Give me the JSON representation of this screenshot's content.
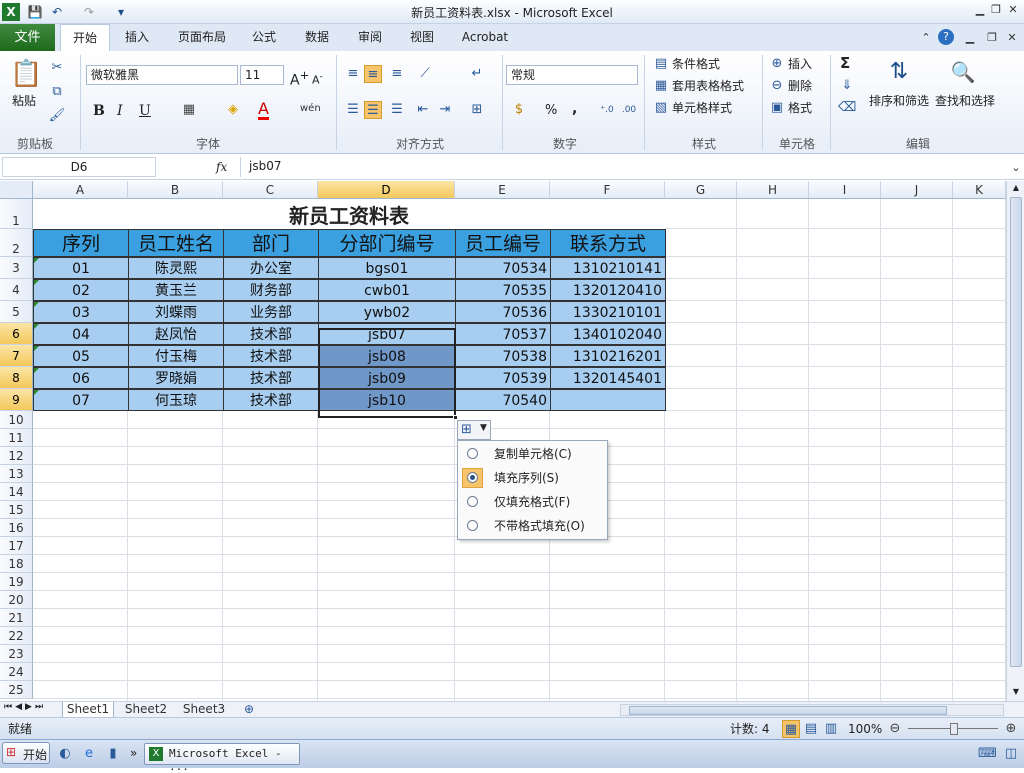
{
  "app": {
    "title": "新员工资料表.xlsx - Microsoft Excel"
  },
  "ribbon_tabs": [
    "开始",
    "插入",
    "页面布局",
    "公式",
    "数据",
    "审阅",
    "视图",
    "Acrobat"
  ],
  "file_tab": "文件",
  "clipboard": {
    "paste": "粘贴",
    "group": "剪贴板"
  },
  "font": {
    "name": "微软雅黑",
    "size": "11",
    "group": "字体",
    "bold": "B",
    "italic": "I",
    "underline": "U",
    "wen": "wén"
  },
  "align": {
    "group": "对齐方式"
  },
  "number": {
    "format": "常规",
    "group": "数字",
    "percent": "%",
    "comma": ",",
    "inc": "+.0 .00",
    "dec": ".00 +.0"
  },
  "styles": {
    "cond": "条件格式",
    "table": "套用表格格式",
    "cell": "单元格样式",
    "group": "样式"
  },
  "cells": {
    "insert": "插入",
    "delete": "删除",
    "format": "格式",
    "group": "单元格"
  },
  "editing": {
    "sort": "排序和筛选",
    "find": "查找和选择",
    "group": "编辑",
    "sum": "Σ"
  },
  "formula_bar": {
    "name_box": "D6",
    "fx": "fx",
    "value": "jsb07"
  },
  "columns": [
    "A",
    "B",
    "C",
    "D",
    "E",
    "F",
    "G",
    "H",
    "I",
    "J",
    "K"
  ],
  "rows": [
    "1",
    "2",
    "3",
    "4",
    "5",
    "6",
    "7",
    "8",
    "9",
    "10",
    "11",
    "12",
    "13",
    "14",
    "15",
    "16",
    "17",
    "18",
    "19",
    "20",
    "21",
    "22",
    "23",
    "24",
    "25"
  ],
  "sheet_title": "新员工资料表",
  "table_headers": [
    "序列",
    "员工姓名",
    "部门",
    "分部门编号",
    "员工编号",
    "联系方式"
  ],
  "table_rows": [
    [
      "01",
      "陈灵熙",
      "办公室",
      "bgs01",
      "70534",
      "1310210141"
    ],
    [
      "02",
      "黄玉兰",
      "财务部",
      "cwb01",
      "70535",
      "1320120410"
    ],
    [
      "03",
      "刘蝶雨",
      "业务部",
      "ywb02",
      "70536",
      "1330210101"
    ],
    [
      "04",
      "赵凤怡",
      "技术部",
      "jsb07",
      "70537",
      "1340102040"
    ],
    [
      "05",
      "付玉梅",
      "技术部",
      "jsb08",
      "70538",
      "1310216201"
    ],
    [
      "06",
      "罗晓娟",
      "技术部",
      "jsb09",
      "70539",
      "1320145401"
    ],
    [
      "07",
      "何玉琼",
      "技术部",
      "jsb10",
      "70540",
      ""
    ]
  ],
  "autofill_menu": {
    "options": [
      "复制单元格(C)",
      "填充序列(S)",
      "仅填充格式(F)",
      "不带格式填充(O)"
    ],
    "selected_index": 1
  },
  "sheets": [
    "Sheet1",
    "Sheet2",
    "Sheet3"
  ],
  "status": {
    "ready": "就绪",
    "count": "计数: 4",
    "zoom": "100%"
  },
  "taskbar": {
    "start": "开始",
    "excel": "Microsoft Excel - ..."
  }
}
